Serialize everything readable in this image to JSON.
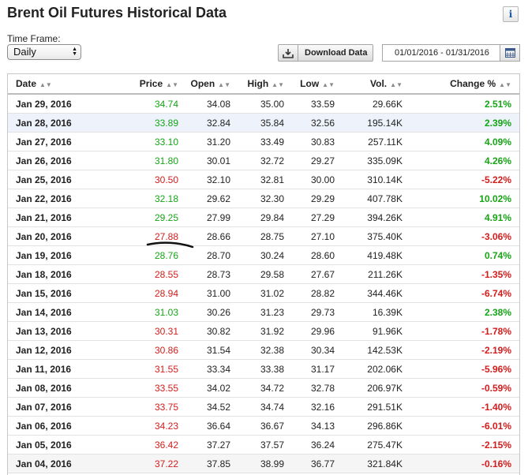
{
  "page": {
    "title": "Brent Oil Futures Historical Data"
  },
  "info_icon": "info-icon",
  "time_frame": {
    "label": "Time Frame:",
    "value": "Daily"
  },
  "download": {
    "label": "Download Data",
    "icon": "download-icon"
  },
  "date_range": {
    "value": "01/01/2016 - 01/31/2016",
    "icon": "calendar-icon"
  },
  "colors": {
    "up": "#15a515",
    "down": "#d51c1c",
    "highlight_row": "#eef3fb"
  },
  "table": {
    "headers": [
      "Date",
      "Price",
      "Open",
      "High",
      "Low",
      "Vol.",
      "Change %"
    ],
    "rows": [
      {
        "date": "Jan 29, 2016",
        "price": "34.74",
        "open": "34.08",
        "high": "35.00",
        "low": "33.59",
        "vol": "29.66K",
        "change": "2.51%",
        "trend": "up"
      },
      {
        "date": "Jan 28, 2016",
        "price": "33.89",
        "open": "32.84",
        "high": "35.84",
        "low": "32.56",
        "vol": "195.14K",
        "change": "2.39%",
        "trend": "up"
      },
      {
        "date": "Jan 27, 2016",
        "price": "33.10",
        "open": "31.20",
        "high": "33.49",
        "low": "30.83",
        "vol": "257.11K",
        "change": "4.09%",
        "trend": "up"
      },
      {
        "date": "Jan 26, 2016",
        "price": "31.80",
        "open": "30.01",
        "high": "32.72",
        "low": "29.27",
        "vol": "335.09K",
        "change": "4.26%",
        "trend": "up"
      },
      {
        "date": "Jan 25, 2016",
        "price": "30.50",
        "open": "32.10",
        "high": "32.81",
        "low": "30.00",
        "vol": "310.14K",
        "change": "-5.22%",
        "trend": "down"
      },
      {
        "date": "Jan 22, 2016",
        "price": "32.18",
        "open": "29.62",
        "high": "32.30",
        "low": "29.29",
        "vol": "407.78K",
        "change": "10.02%",
        "trend": "up"
      },
      {
        "date": "Jan 21, 2016",
        "price": "29.25",
        "open": "27.99",
        "high": "29.84",
        "low": "27.29",
        "vol": "394.26K",
        "change": "4.91%",
        "trend": "up"
      },
      {
        "date": "Jan 20, 2016",
        "price": "27.88",
        "open": "28.66",
        "high": "28.75",
        "low": "27.10",
        "vol": "375.40K",
        "change": "-3.06%",
        "trend": "down"
      },
      {
        "date": "Jan 19, 2016",
        "price": "28.76",
        "open": "28.70",
        "high": "30.24",
        "low": "28.60",
        "vol": "419.48K",
        "change": "0.74%",
        "trend": "up"
      },
      {
        "date": "Jan 18, 2016",
        "price": "28.55",
        "open": "28.73",
        "high": "29.58",
        "low": "27.67",
        "vol": "211.26K",
        "change": "-1.35%",
        "trend": "down"
      },
      {
        "date": "Jan 15, 2016",
        "price": "28.94",
        "open": "31.00",
        "high": "31.02",
        "low": "28.82",
        "vol": "344.46K",
        "change": "-6.74%",
        "trend": "down"
      },
      {
        "date": "Jan 14, 2016",
        "price": "31.03",
        "open": "30.26",
        "high": "31.23",
        "low": "29.73",
        "vol": "16.39K",
        "change": "2.38%",
        "trend": "up"
      },
      {
        "date": "Jan 13, 2016",
        "price": "30.31",
        "open": "30.82",
        "high": "31.92",
        "low": "29.96",
        "vol": "91.96K",
        "change": "-1.78%",
        "trend": "down"
      },
      {
        "date": "Jan 12, 2016",
        "price": "30.86",
        "open": "31.54",
        "high": "32.38",
        "low": "30.34",
        "vol": "142.53K",
        "change": "-2.19%",
        "trend": "down"
      },
      {
        "date": "Jan 11, 2016",
        "price": "31.55",
        "open": "33.34",
        "high": "33.38",
        "low": "31.17",
        "vol": "202.06K",
        "change": "-5.96%",
        "trend": "down"
      },
      {
        "date": "Jan 08, 2016",
        "price": "33.55",
        "open": "34.02",
        "high": "34.72",
        "low": "32.78",
        "vol": "206.97K",
        "change": "-0.59%",
        "trend": "down"
      },
      {
        "date": "Jan 07, 2016",
        "price": "33.75",
        "open": "34.52",
        "high": "34.74",
        "low": "32.16",
        "vol": "291.51K",
        "change": "-1.40%",
        "trend": "down"
      },
      {
        "date": "Jan 06, 2016",
        "price": "34.23",
        "open": "36.64",
        "high": "36.67",
        "low": "34.13",
        "vol": "296.86K",
        "change": "-6.01%",
        "trend": "down"
      },
      {
        "date": "Jan 05, 2016",
        "price": "36.42",
        "open": "37.27",
        "high": "37.57",
        "low": "36.24",
        "vol": "275.47K",
        "change": "-2.15%",
        "trend": "down"
      },
      {
        "date": "Jan 04, 2016",
        "price": "37.22",
        "open": "37.85",
        "high": "38.99",
        "low": "36.77",
        "vol": "321.84K",
        "change": "-0.16%",
        "trend": "down"
      }
    ]
  }
}
